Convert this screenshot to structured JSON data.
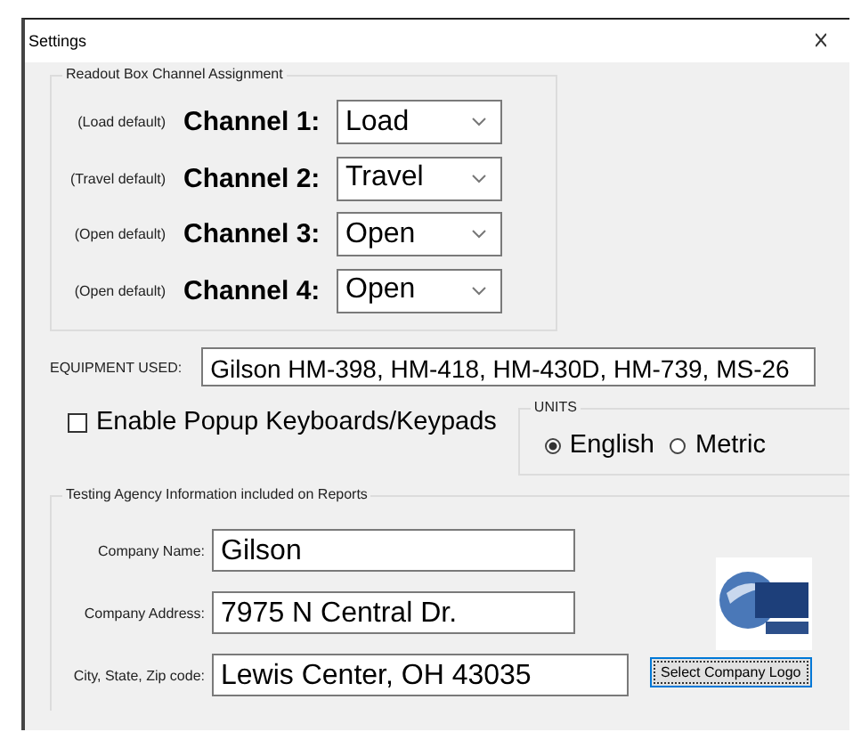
{
  "window": {
    "title": "Settings"
  },
  "channel_group": {
    "title": "Readout Box Channel Assignment",
    "channels": [
      {
        "default_note": "(Load default)",
        "label": "Channel 1:",
        "value": "Load"
      },
      {
        "default_note": "(Travel default)",
        "label": "Channel 2:",
        "value": "Travel"
      },
      {
        "default_note": "(Open default)",
        "label": "Channel 3:",
        "value": "Open"
      },
      {
        "default_note": "(Open default)",
        "label": "Channel 4:",
        "value": "Open"
      }
    ]
  },
  "equipment": {
    "label": "EQUIPMENT USED:",
    "value": "Gilson HM-398, HM-418, HM-430D, HM-739, MS-26"
  },
  "popup_keyboards": {
    "label": "Enable Popup Keyboards/Keypads",
    "checked": false
  },
  "units": {
    "title": "UNITS",
    "options": [
      {
        "label": "English",
        "selected": true
      },
      {
        "label": "Metric",
        "selected": false
      }
    ]
  },
  "agency_group": {
    "title": "Testing Agency Information included on Reports",
    "fields": [
      {
        "label": "Company Name:",
        "value": "Gilson"
      },
      {
        "label": "Company Address:",
        "value": "7975 N Central Dr."
      },
      {
        "label": "City, State, Zip code:",
        "value": "Lewis Center, OH 43035"
      }
    ],
    "logo_button": "Select Company Logo"
  }
}
